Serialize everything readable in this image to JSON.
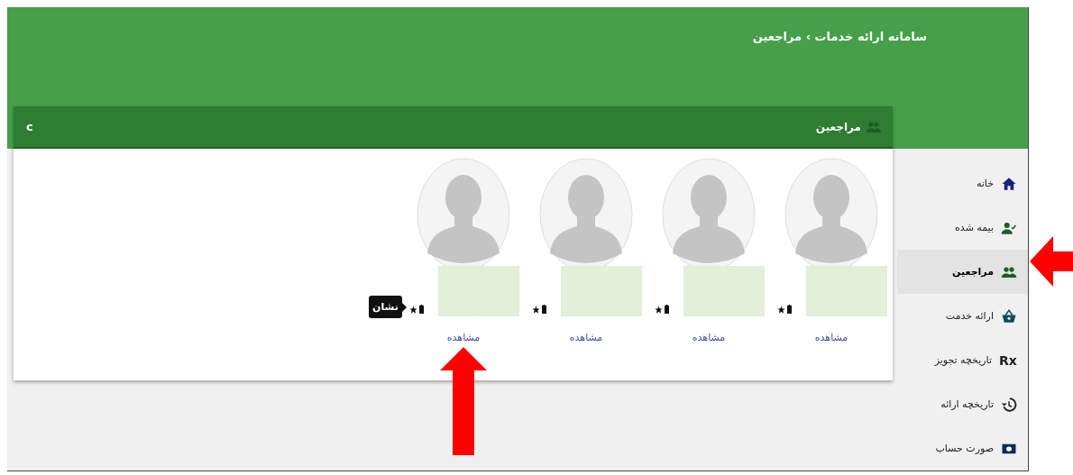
{
  "header": {
    "breadcrumb": "سامانه ارائه خدمات › مراجعین"
  },
  "panel": {
    "title": "مراجعین",
    "refresh": "c"
  },
  "clients": [
    {
      "link": "مشاهده"
    },
    {
      "link": "مشاهده"
    },
    {
      "link": "مشاهده"
    },
    {
      "link": "مشاهده",
      "tooltip": "نشان"
    }
  ],
  "sidebar": {
    "items": [
      {
        "label": "خانه",
        "kind": "home",
        "selected": false
      },
      {
        "label": "بیمه شده",
        "kind": "insured",
        "selected": false
      },
      {
        "label": "مراجعین",
        "kind": "clients",
        "selected": true
      },
      {
        "label": "ارائه خدمت",
        "kind": "service",
        "selected": false
      },
      {
        "label": "تاریخچه تجویز",
        "kind": "prescription",
        "glyph": "Rx",
        "selected": false
      },
      {
        "label": "تاریخچه ارائه",
        "kind": "history",
        "selected": false
      },
      {
        "label": "صورت حساب",
        "kind": "invoice",
        "selected": false
      }
    ]
  },
  "annotations": [
    {
      "kind": "arrow-left"
    },
    {
      "kind": "arrow-up"
    }
  ]
}
